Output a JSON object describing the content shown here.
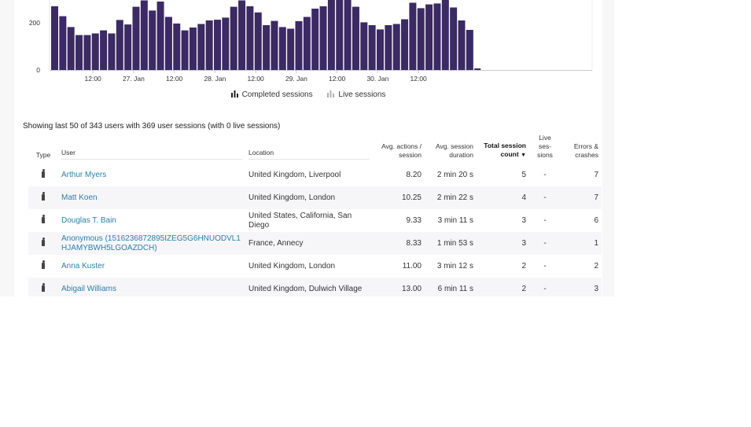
{
  "chart_data": {
    "type": "bar",
    "series": [
      {
        "name": "Completed sessions",
        "color": "#3b2a63",
        "values": [
          270,
          228,
          182,
          148,
          148,
          155,
          168,
          155,
          212,
          193,
          268,
          295,
          252,
          290,
          225,
          197,
          168,
          180,
          195,
          210,
          213,
          222,
          268,
          295,
          270,
          244,
          190,
          208,
          182,
          175,
          207,
          225,
          260,
          270,
          298,
          305,
          322,
          268,
          202,
          190,
          172,
          190,
          195,
          215,
          285,
          262,
          278,
          282,
          305,
          265,
          210,
          170
        ]
      },
      {
        "name": "Live sessions",
        "color": "#b9b9c4",
        "values": []
      }
    ],
    "y_ticks": [
      "0",
      "200"
    ],
    "x_ticks": [
      {
        "label": "12:00",
        "index": 4.7
      },
      {
        "label": "27. Jan",
        "index": 9.7
      },
      {
        "label": "12:00",
        "index": 14.7
      },
      {
        "label": "28. Jan",
        "index": 19.7
      },
      {
        "label": "12:00",
        "index": 24.7
      },
      {
        "label": "29. Jan",
        "index": 29.7
      },
      {
        "label": "12:00",
        "index": 34.7
      },
      {
        "label": "30. Jan",
        "index": 39.7
      },
      {
        "label": "12:00",
        "index": 44.7
      }
    ],
    "ylim": [
      0,
      330
    ],
    "grid": false
  },
  "legend": {
    "completed_label": "Completed sessions",
    "live_label": "Live sessions"
  },
  "summary_text": "Showing last 50 of 343 users with 369 user sessions (with 0 live sessions)",
  "table": {
    "headers": {
      "type": "Type",
      "user": "User",
      "location": "Location",
      "actions_1": "Avg. actions /",
      "actions_2": "session",
      "duration_1": "Avg. session",
      "duration_2": "duration",
      "total_1": "Total session",
      "total_2": "count",
      "live_1": "Live",
      "live_2": "ses-",
      "live_3": "sions",
      "errors_1": "Errors &",
      "errors_2": "crashes"
    },
    "rows": [
      {
        "user": "Arthur Myers",
        "location": "United Kingdom, Liverpool",
        "actions": "8.20",
        "duration": "2 min 20 s",
        "total": "5",
        "live": "-",
        "errors": "7"
      },
      {
        "user": "Matt Koen",
        "location": "United Kingdom, London",
        "actions": "10.25",
        "duration": "2 min 22 s",
        "total": "4",
        "live": "-",
        "errors": "7"
      },
      {
        "user": "Douglas T. Bain",
        "location": "United States, California, San Diego",
        "actions": "9.33",
        "duration": "3 min 11 s",
        "total": "3",
        "live": "-",
        "errors": "6"
      },
      {
        "user": "Anonymous (1516236872895IZEG5G6HNUODVL1HJAMYBWH5LGOAZDCH)",
        "location": "France, Annecy",
        "actions": "8.33",
        "duration": "1 min 53 s",
        "total": "3",
        "live": "-",
        "errors": "1"
      },
      {
        "user": "Anna Kuster",
        "location": "United Kingdom, London",
        "actions": "11.00",
        "duration": "3 min 12 s",
        "total": "2",
        "live": "-",
        "errors": "2"
      },
      {
        "user": "Abigail Williams",
        "location": "United Kingdom, Dulwich Village",
        "actions": "13.00",
        "duration": "6 min 11 s",
        "total": "2",
        "live": "-",
        "errors": "3"
      }
    ]
  }
}
